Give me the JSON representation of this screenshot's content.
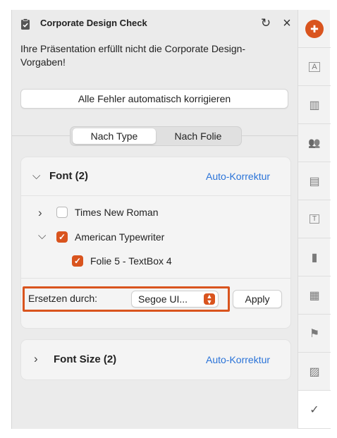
{
  "colors": {
    "accent": "#d9541e",
    "link": "#2a73d8"
  },
  "header": {
    "title": "Corporate Design Check",
    "icon": "clipboard-check-icon",
    "refresh_icon": "↻",
    "close_icon": "×"
  },
  "message": "Ihre Präsentation erfüllt nicht die Corporate Design-Vorgaben!",
  "fix_all_label": "Alle Fehler automatisch korrigieren",
  "tabs": [
    {
      "label": "Nach Type",
      "selected": true
    },
    {
      "label": "Nach Folie",
      "selected": false
    }
  ],
  "font_section": {
    "title": "Font (2)",
    "action": "Auto-Korrektur",
    "expanded": true,
    "chevron": "⌵",
    "items": [
      {
        "label": "Times New Roman",
        "checked": false,
        "expanded": false,
        "chevron": "›"
      },
      {
        "label": "American Typewriter",
        "checked": true,
        "expanded": true,
        "chevron": "⌵"
      }
    ],
    "sub_items": [
      {
        "label": "Folie 5 - TextBox 4",
        "checked": true
      }
    ],
    "replace_label": "Ersetzen durch:",
    "replace_value": "Segoe UI...",
    "apply_label": "Apply"
  },
  "font_size_section": {
    "title": "Font Size (2)",
    "action": "Auto-Korrektur",
    "expanded": false,
    "chevron": "›"
  },
  "sidebar": {
    "items": [
      {
        "name": "brand-logo-icon",
        "glyph": "✚"
      },
      {
        "name": "text-style-icon",
        "glyph": "A"
      },
      {
        "name": "library-icon",
        "glyph": "▥"
      },
      {
        "name": "people-icon",
        "glyph": "👥"
      },
      {
        "name": "layout-icon",
        "glyph": "▤"
      },
      {
        "name": "text-box-icon",
        "glyph": "T"
      },
      {
        "name": "chart-icon",
        "glyph": "▮"
      },
      {
        "name": "table-icon",
        "glyph": "▦"
      },
      {
        "name": "location-icon",
        "glyph": "⚑"
      },
      {
        "name": "image-icon",
        "glyph": "▨"
      },
      {
        "name": "design-check-icon",
        "glyph": "✓"
      }
    ]
  }
}
